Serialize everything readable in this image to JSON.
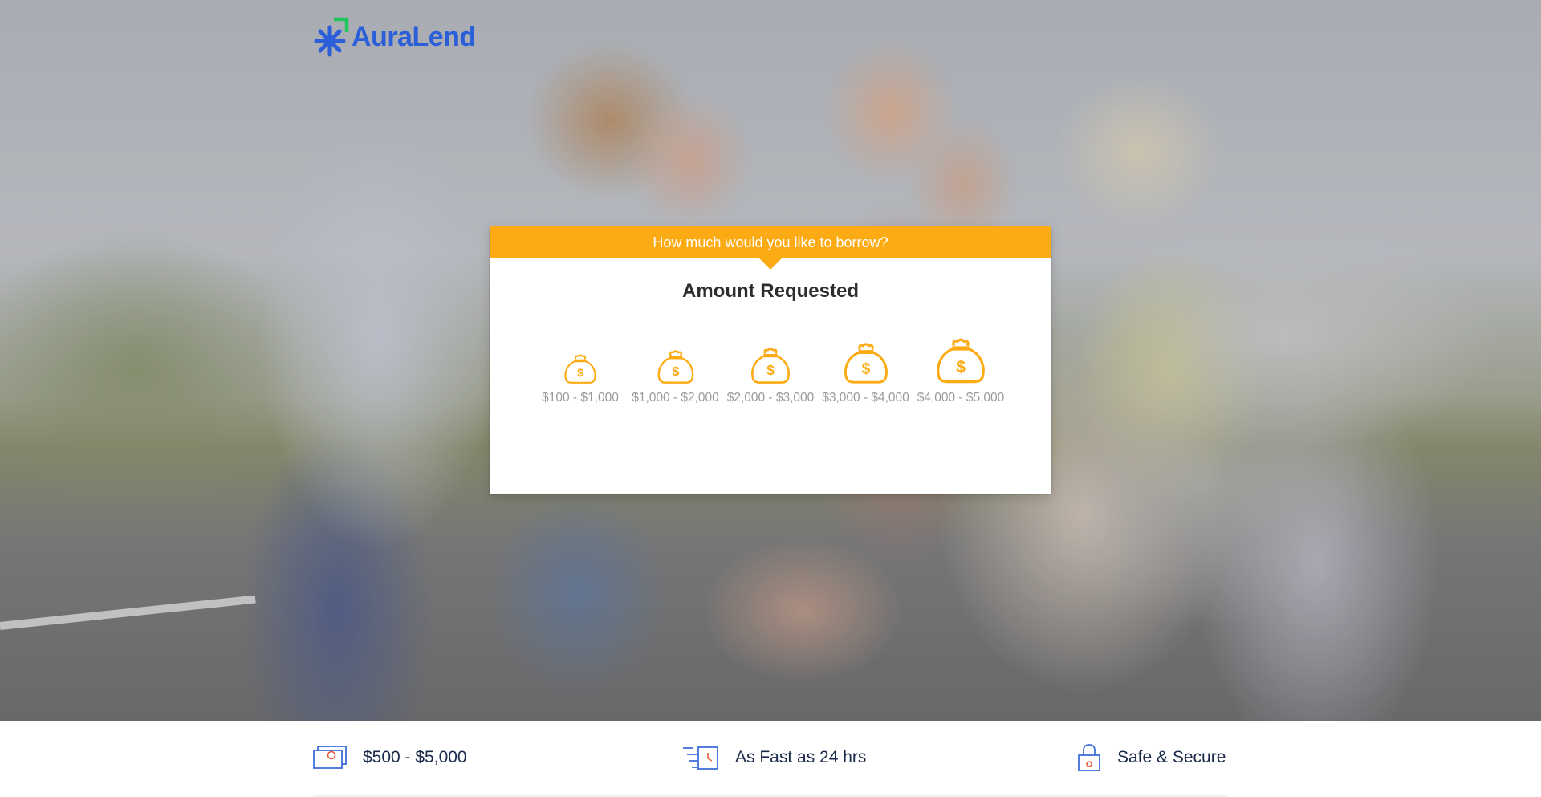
{
  "brand": {
    "name": "AuraLend"
  },
  "card": {
    "header": "How much would you like to borrow?",
    "title": "Amount Requested",
    "options": [
      {
        "label": "$100 - $1,000"
      },
      {
        "label": "$1,000 - $2,000"
      },
      {
        "label": "$2,000 - $3,000"
      },
      {
        "label": "$3,000 - $4,000"
      },
      {
        "label": "$4,000 - $5,000"
      }
    ]
  },
  "features": [
    {
      "icon": "money-bill-icon",
      "text": "$500 - $5,000"
    },
    {
      "icon": "fast-clock-icon",
      "text": "As Fast as 24 hrs"
    },
    {
      "icon": "lock-icon",
      "text": "Safe & Secure"
    }
  ],
  "colors": {
    "accent": "#fdab14",
    "brand_blue": "#2b5fd9",
    "brand_green": "#22c55e",
    "feature_text": "#1a2a4a",
    "option_label": "#9b9b9b"
  }
}
